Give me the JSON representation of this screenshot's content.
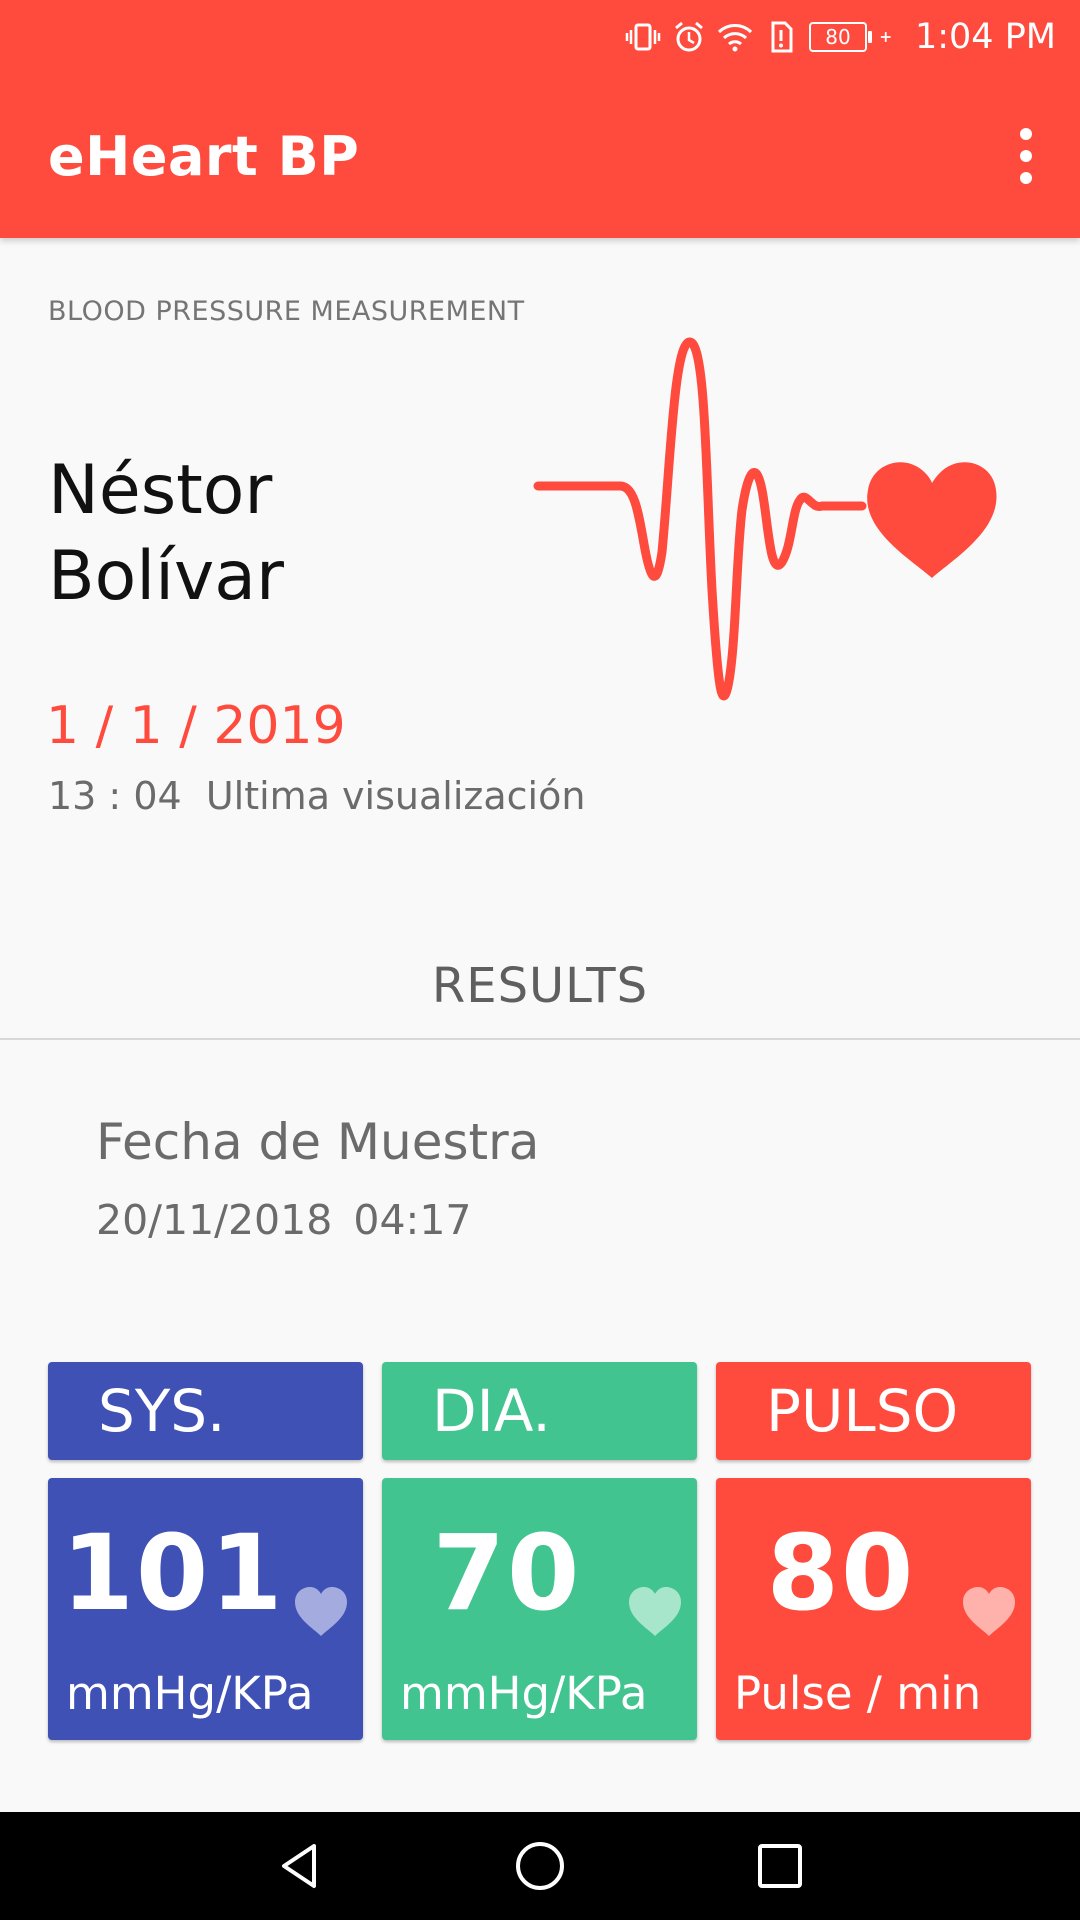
{
  "status_bar": {
    "battery_level": "80",
    "time": "1:04 PM",
    "icons": [
      "vibrate-icon",
      "alarm-icon",
      "wifi-icon",
      "sim-alert-icon",
      "battery-icon",
      "charging-plus-icon"
    ]
  },
  "app_bar": {
    "title": "eHeart BP",
    "menu_icon": "more-vert-icon"
  },
  "header": {
    "section_label": "BLOOD PRESSURE MEASUREMENT",
    "patient_first": "Néstor",
    "patient_last": "Bolívar",
    "date": "1 / 1 / 2019",
    "time": "13 : 04",
    "last_view_label": "Ultima visualización",
    "illustration": "ecg-heart-icon"
  },
  "results": {
    "title": "RESULTS",
    "sample_label": "Fecha de Muestra",
    "sample_date": "20/11/2018",
    "sample_time": "04:17"
  },
  "measurements": [
    {
      "label": "SYS.",
      "value": "101",
      "unit": "mmHg/KPa",
      "color": "#3f51b5",
      "heart_color": "#a4acdf"
    },
    {
      "label": "DIA.",
      "value": "70",
      "unit": "mmHg/KPa",
      "color": "#41c48f",
      "heart_color": "#a8e6cc"
    },
    {
      "label": "PULSO",
      "value": "80",
      "unit": "Pulse / min",
      "color": "#fe4b3e",
      "heart_color": "#ffb2ac"
    }
  ],
  "colors": {
    "primary": "#fe4b3e",
    "background": "#f9f9f9"
  },
  "nav_bar": {
    "icons": [
      "back-icon",
      "home-icon",
      "recents-icon"
    ]
  }
}
